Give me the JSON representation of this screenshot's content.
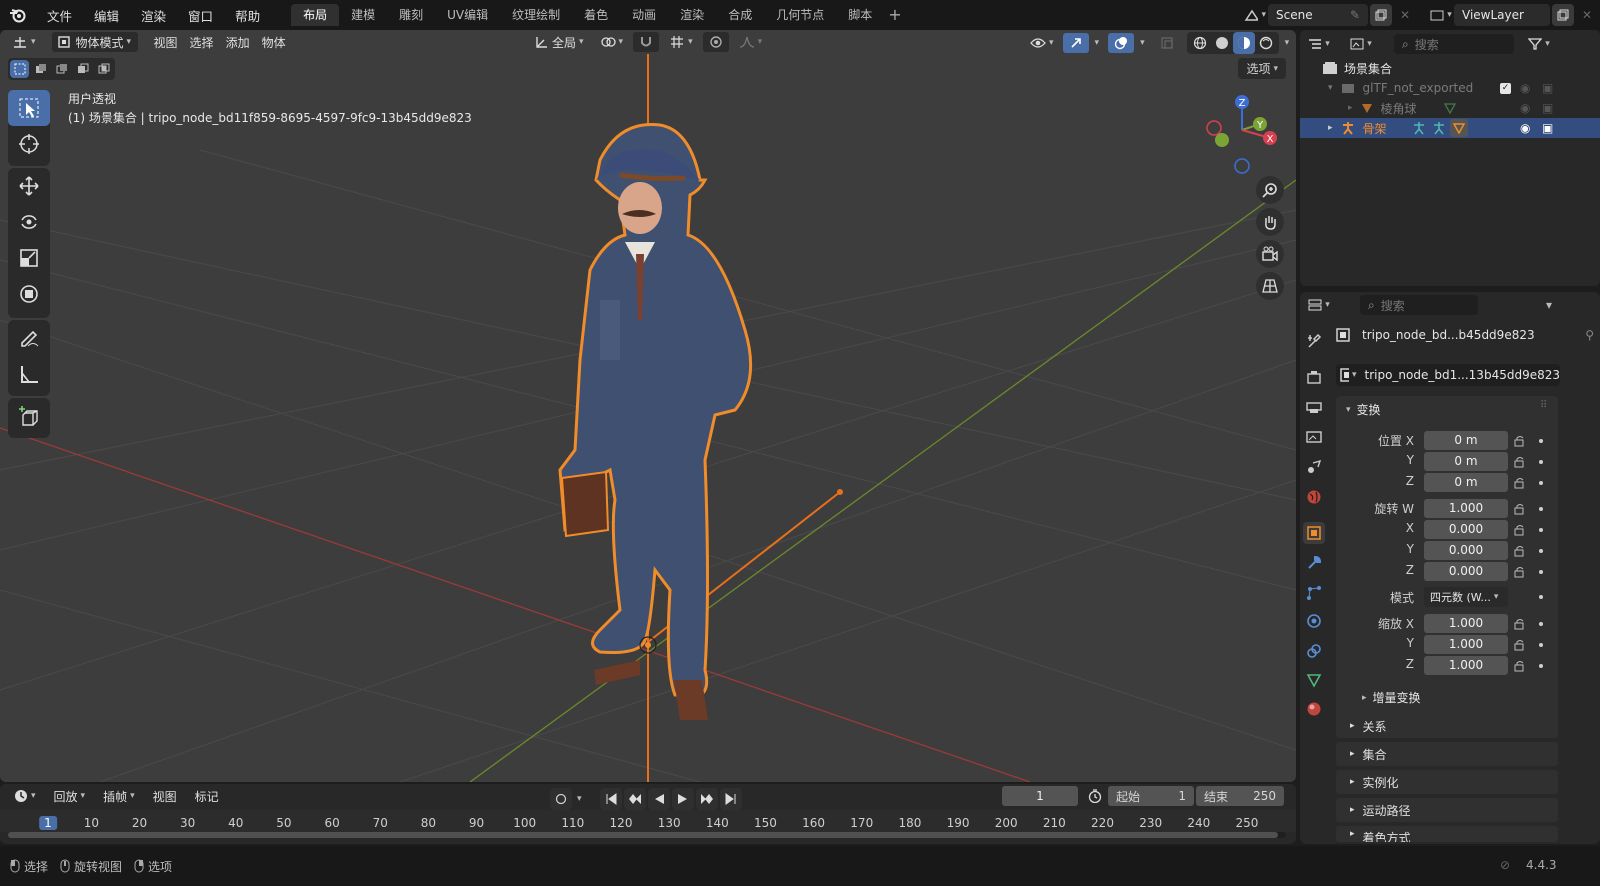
{
  "topbar": {
    "menus": [
      "文件",
      "编辑",
      "渲染",
      "窗口",
      "帮助"
    ],
    "workspaces": [
      "布局",
      "建模",
      "雕刻",
      "UV编辑",
      "纹理绘制",
      "着色",
      "动画",
      "渲染",
      "合成",
      "几何节点",
      "脚本"
    ],
    "active_workspace": "布局",
    "scene_name": "Scene",
    "view_layer": "ViewLayer"
  },
  "viewport": {
    "mode": "物体模式",
    "menus": [
      "视图",
      "选择",
      "添加",
      "物体"
    ],
    "orientation": "全局",
    "options_label": "选项",
    "view_name": "用户透视",
    "object_info": "(1) 场景集合 | tripo_node_bd11f859-8695-4597-9fc9-13b45dd9e823",
    "gizmo_labels": {
      "x": "X",
      "y": "Y",
      "z": "Z"
    }
  },
  "outliner": {
    "search_placeholder": "搜索",
    "root": "场景集合",
    "items": [
      {
        "label": "glTF_not_exported",
        "level": 1
      },
      {
        "label": "棱角球",
        "level": 2
      },
      {
        "label": "骨架",
        "level": 1
      }
    ]
  },
  "properties": {
    "search_placeholder": "搜索",
    "object_name": "tripo_node_bd...b45dd9e823",
    "data_name": "tripo_node_bd1...13b45dd9e823",
    "transform_header": "变换",
    "location_label": "位置 X",
    "location": [
      "0 m",
      "0 m",
      "0 m"
    ],
    "rotation_label": "旋转 W",
    "rotation": [
      "1.000",
      "0.000",
      "0.000",
      "0.000"
    ],
    "mode_label": "模式",
    "mode_value": "四元数 (W...",
    "scale_label": "缩放 X",
    "scale": [
      "1.000",
      "1.000",
      "1.000"
    ],
    "axis_y": "Y",
    "axis_z": "Z",
    "axis_x": "X",
    "delta": "增量变换",
    "sections": [
      "关系",
      "集合",
      "实例化",
      "运动路径",
      "着色方式"
    ]
  },
  "timeline": {
    "menus": [
      "回放",
      "插帧",
      "视图",
      "标记"
    ],
    "current_frame": "1",
    "start_label": "起始",
    "start": "1",
    "end_label": "结束",
    "end": "250",
    "ticks": [
      "1",
      "10",
      "20",
      "30",
      "40",
      "50",
      "60",
      "70",
      "80",
      "90",
      "100",
      "110",
      "120",
      "130",
      "140",
      "150",
      "160",
      "170",
      "180",
      "190",
      "200",
      "210",
      "220",
      "230",
      "240",
      "250"
    ]
  },
  "statusbar": {
    "items": [
      "选择",
      "旋转视图",
      "选项"
    ],
    "version": "4.4.3"
  },
  "colors": {
    "accent": "#4a6fa8",
    "selection": "#f08c2a"
  }
}
